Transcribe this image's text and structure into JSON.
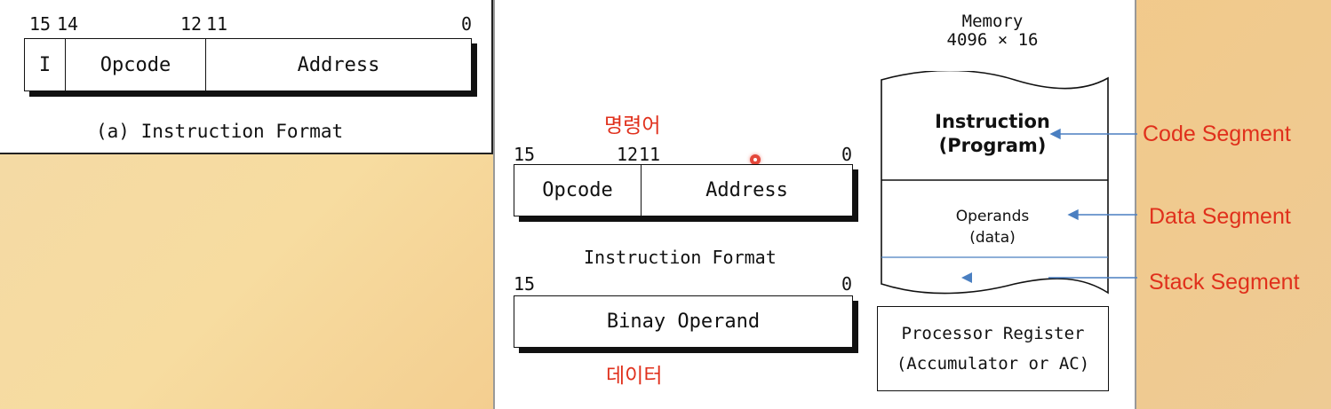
{
  "panel_a": {
    "bits": [
      "15",
      "14",
      "12",
      "11",
      "0"
    ],
    "fields": [
      "I",
      "Opcode",
      "Address"
    ],
    "caption": "(a) Instruction Format"
  },
  "panel_b": {
    "instruction": {
      "label_ko": "명령어",
      "bits": [
        "15",
        "12",
        "11",
        "0"
      ],
      "fields": [
        "Opcode",
        "Address"
      ],
      "caption": "Instruction Format"
    },
    "operand": {
      "bits": [
        "15",
        "0"
      ],
      "field": "Binay Operand",
      "label_ko": "데이터"
    },
    "memory": {
      "title": "Memory",
      "size": "4096 × 16",
      "instruction_line1": "Instruction",
      "instruction_line2": "(Program)",
      "operands_line1": "Operands",
      "operands_line2": "(data)"
    },
    "register": {
      "line1": "Processor Register",
      "line2": "(Accumulator or AC)"
    }
  },
  "segments": [
    "Code Segment",
    "Data Segment",
    "Stack Segment"
  ],
  "colors": {
    "annotation_red": "#e0301c",
    "arrow_blue": "#4a7fc1"
  }
}
